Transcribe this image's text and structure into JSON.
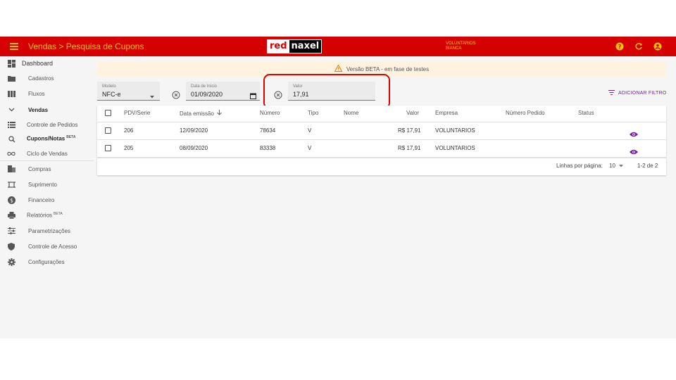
{
  "header": {
    "title": "Vendas > Pesquisa de Cupons",
    "logo_part1": "red",
    "logo_part2": "naxel",
    "user_line1": "VOLUNTARIOS",
    "user_line2": "BIANCA"
  },
  "sidebar": {
    "items": [
      {
        "label": "Dashboard",
        "icon": "dashboard-icon"
      },
      {
        "label": "Cadastros",
        "icon": "folder-icon"
      },
      {
        "label": "Fluxos",
        "icon": "columns-icon"
      },
      {
        "label": "Vendas",
        "icon": "chevron-down-icon"
      },
      {
        "label": "Controle de Pedidos",
        "icon": "list-icon"
      },
      {
        "label": "Cupons/Notas",
        "badge": "BETA",
        "icon": "receipt-search-icon"
      },
      {
        "label": "Ciclo de Vendas",
        "icon": "infinity-icon"
      },
      {
        "label": "Compras",
        "icon": "building-icon"
      },
      {
        "label": "Suprimento",
        "icon": "crop-icon"
      },
      {
        "label": "Financeiro",
        "icon": "money-icon"
      },
      {
        "label": "Relatórios",
        "badge": "BETA",
        "icon": "printer-icon"
      },
      {
        "label": "Parametrizações",
        "icon": "sliders-icon"
      },
      {
        "label": "Controle de Acesso",
        "icon": "shield-icon"
      },
      {
        "label": "Configurações",
        "icon": "gear-icon"
      }
    ]
  },
  "banner": {
    "text": "Versão BETA - em fase de testes"
  },
  "filters": {
    "modelo_label": "Modelo",
    "modelo_value": "NFC-e",
    "data_label": "Data de Início",
    "data_value": "01/09/2020",
    "valor_label": "Valor",
    "valor_value": "17,91",
    "add_filter": "ADICIONAR FILTRO"
  },
  "table": {
    "headers": {
      "pdv": "PDV/Serie",
      "data": "Data emissão",
      "numero": "Número",
      "tipo": "Tipo",
      "nome": "Nome",
      "valor": "Valor",
      "empresa": "Empresa",
      "pedido": "Número Pedido",
      "status": "Status"
    },
    "rows": [
      {
        "pdv": "206",
        "data": "12/09/2020",
        "numero": "78634",
        "tipo": "V",
        "nome": "",
        "valor": "R$ 17,91",
        "empresa": "VOLUNTARIOS",
        "pedido": "",
        "status": ""
      },
      {
        "pdv": "205",
        "data": "08/09/2020",
        "numero": "83338",
        "tipo": "V",
        "nome": "",
        "valor": "R$ 17,91",
        "empresa": "VOLUNTARIOS",
        "pedido": "",
        "status": ""
      }
    ],
    "footer": {
      "rows_per_page_label": "Linhas por página:",
      "rows_per_page_value": "10",
      "range": "1-2 de 2"
    }
  },
  "colors": {
    "brand": "#d50000",
    "accent": "#ffc107",
    "action": "#7b1fa2"
  }
}
